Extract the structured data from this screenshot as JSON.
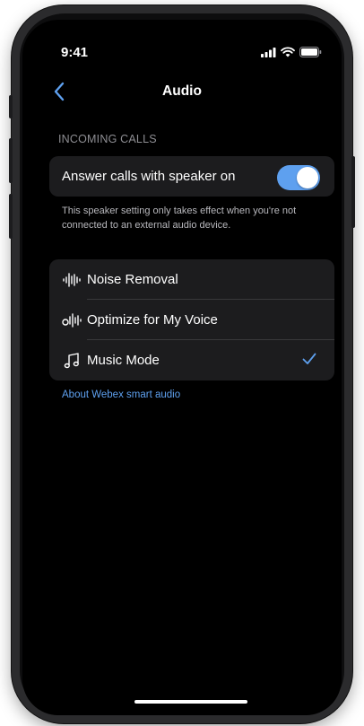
{
  "status_bar": {
    "time": "9:41"
  },
  "nav": {
    "title": "Audio"
  },
  "incoming_calls": {
    "header": "INCOMING CALLS",
    "speaker_label": "Answer calls with speaker on",
    "speaker_on": true,
    "footnote": "This speaker setting only takes effect when you're not connected to an external audio device."
  },
  "audio_modes": [
    {
      "label": "Noise Removal",
      "icon": "noise-removal-icon",
      "selected": false
    },
    {
      "label": "Optimize for My Voice",
      "icon": "voice-optimize-icon",
      "selected": false
    },
    {
      "label": "Music Mode",
      "icon": "music-note-icon",
      "selected": true
    }
  ],
  "about_link": "About Webex smart audio",
  "colors": {
    "accent": "#5ea0ef",
    "cell_bg": "#1c1c1e",
    "background": "#000000"
  }
}
